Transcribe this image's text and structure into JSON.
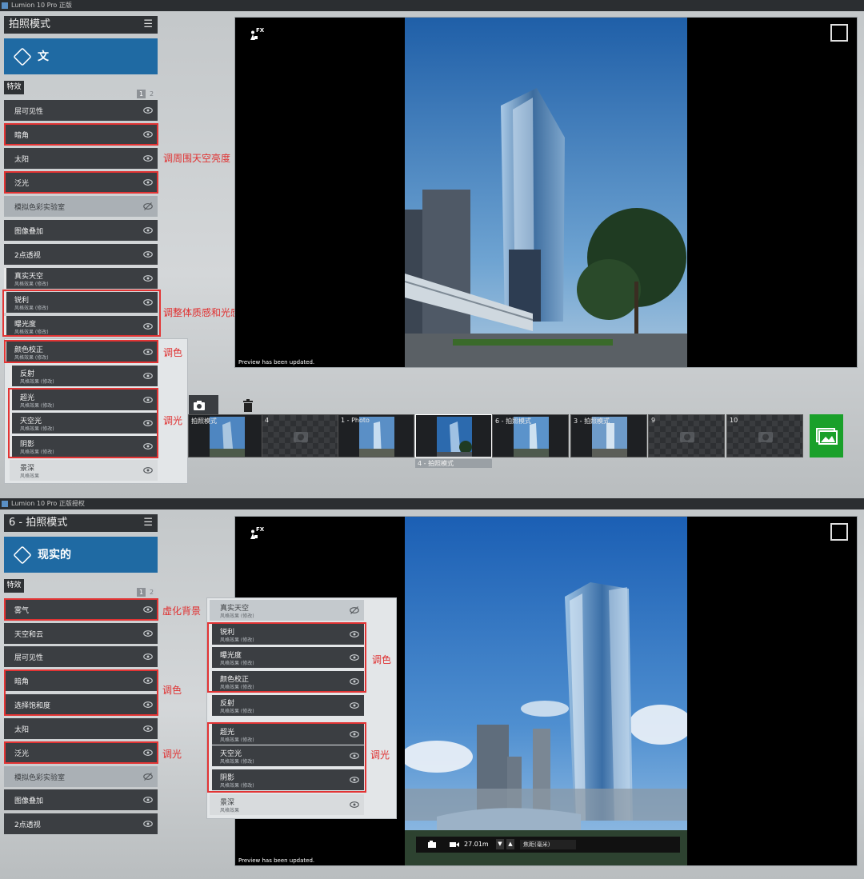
{
  "shot1": {
    "window_title": "Lumion 10 Pro 正版",
    "mode_title": "拍照模式",
    "preset_label": "文",
    "tab_label": "特效",
    "pages": [
      "1",
      "2"
    ],
    "effects": [
      {
        "name": "层可见性",
        "sub": ""
      },
      {
        "name": "暗角",
        "sub": ""
      },
      {
        "name": "太阳",
        "sub": ""
      },
      {
        "name": "泛光",
        "sub": ""
      },
      {
        "name": "模拟色彩实验室",
        "sub": ""
      },
      {
        "name": "图像叠加",
        "sub": ""
      },
      {
        "name": "2点透视",
        "sub": ""
      },
      {
        "name": "真实天空",
        "sub": "风格效果 (修改)"
      },
      {
        "name": "锐利",
        "sub": "风格效果 (修改)"
      },
      {
        "name": "曝光度",
        "sub": "风格效果 (修改)"
      },
      {
        "name": "颜色校正",
        "sub": "风格效果 (修改)"
      },
      {
        "name": "反射",
        "sub": "风格效果 (修改)"
      },
      {
        "name": "超光",
        "sub": "风格效果 (修改)"
      },
      {
        "name": "天空光",
        "sub": "风格效果 (修改)"
      },
      {
        "name": "阴影",
        "sub": "风格效果 (修改)"
      },
      {
        "name": "景深",
        "sub": "风格效果"
      }
    ],
    "notes": {
      "vignette": "调周围天空亮度",
      "texture": "调整体质感和光感",
      "color": "调色",
      "light": "调光"
    },
    "fx_badge": "FX",
    "preview_status": "Preview has been updated.",
    "thumbnails": [
      {
        "label": "拍照模式"
      },
      {
        "label": "4"
      },
      {
        "label": "1 - Photo"
      },
      {
        "label": ""
      },
      {
        "label": "6 - 拍照模式"
      },
      {
        "label": "3 - 拍照模式"
      },
      {
        "label": "9"
      },
      {
        "label": "10"
      }
    ],
    "selected_caption": "4 - 拍照模式"
  },
  "shot2": {
    "window_title": "Lumion 10 Pro 正版授权",
    "mode_title": "6 - 拍照模式",
    "preset_label": "现实的",
    "tab_label": "特效",
    "pages": [
      "1",
      "2"
    ],
    "effects": [
      {
        "name": "雾气",
        "sub": ""
      },
      {
        "name": "天空和云",
        "sub": ""
      },
      {
        "name": "层可见性",
        "sub": ""
      },
      {
        "name": "暗角",
        "sub": ""
      },
      {
        "name": "选择饱和度",
        "sub": ""
      },
      {
        "name": "太阳",
        "sub": ""
      },
      {
        "name": "泛光",
        "sub": ""
      },
      {
        "name": "模拟色彩实验室",
        "sub": ""
      },
      {
        "name": "图像叠加",
        "sub": ""
      },
      {
        "name": "2点透视",
        "sub": ""
      }
    ],
    "panel_effects": [
      {
        "name": "真实天空",
        "sub": "风格效果 (修改)"
      },
      {
        "name": "锐利",
        "sub": "风格效果 (修改)"
      },
      {
        "name": "曝光度",
        "sub": "风格效果 (修改)"
      },
      {
        "name": "颜色校正",
        "sub": "风格效果 (修改)"
      },
      {
        "name": "反射",
        "sub": "风格效果 (修改)"
      },
      {
        "name": "超光",
        "sub": "风格效果 (修改)"
      },
      {
        "name": "天空光",
        "sub": "风格效果 (修改)"
      },
      {
        "name": "阴影",
        "sub": "风格效果 (修改)"
      },
      {
        "name": "景深",
        "sub": "风格效果"
      }
    ],
    "notes": {
      "fog": "虚化背景",
      "color_left": "调色",
      "light_left": "调光",
      "color_right": "调色",
      "light_right": "调光"
    },
    "fx_badge": "FX",
    "preview_status": "Preview has been updated.",
    "camera": {
      "height": "27.01m",
      "focal_label": "焦距(毫米)"
    }
  },
  "colors": {
    "accent": "#1f6aa3",
    "annotation": "#e23434",
    "render_button": "#1aa02a"
  }
}
